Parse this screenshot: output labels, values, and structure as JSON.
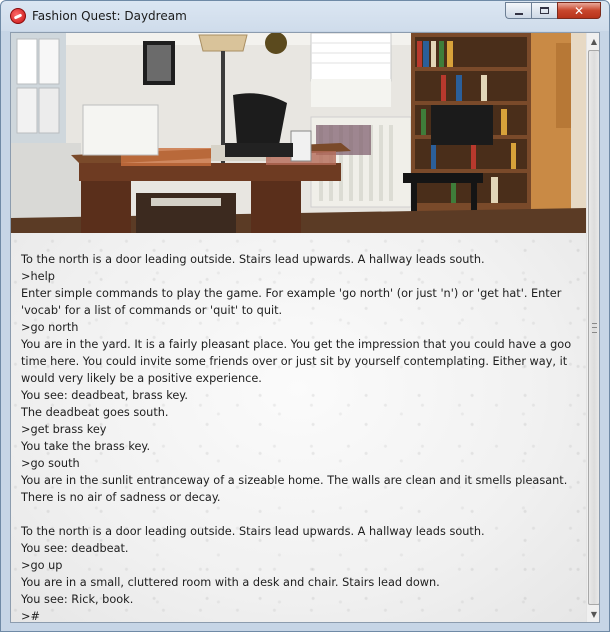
{
  "window": {
    "title": "Fashion Quest: Daydream",
    "min_icon": "minimize-icon",
    "max_icon": "maximize-icon",
    "close_glyph": "✕"
  },
  "scene": {
    "icon": "room-photo",
    "colors": {
      "wall": "#e9e7e2",
      "floor": "#5b3b25",
      "desk": "#6e3b22",
      "shelf": "#7a4a2a",
      "door": "#c98a45"
    }
  },
  "log": {
    "lines": [
      "To the north is a door leading outside. Stairs lead upwards. A hallway leads south.",
      ">help",
      "Enter simple commands to play the game. For example 'go north' (or just 'n') or 'get hat'. Enter",
      "'vocab' for a list of commands or 'quit' to quit.",
      ">go north",
      "You are in the yard. It is a fairly pleasant place. You get the impression that you could have a goo",
      "time here. You could invite some friends over or just sit by yourself contemplating. Either way, it",
      "would very likely be a positive experience.",
      "You see: deadbeat, brass key.",
      "The deadbeat goes south.",
      ">get brass key",
      "You take the brass key.",
      ">go south",
      "You are in the sunlit entranceway of a sizeable home. The walls are clean and it smells pleasant.",
      "There is no air of sadness or decay.",
      "",
      "To the north is a door leading outside. Stairs lead upwards. A hallway leads south.",
      "You see: deadbeat.",
      ">go up",
      "You are in a small, cluttered room with a desk and chair. Stairs lead down.",
      "You see: Rick, book.",
      ">#"
    ]
  },
  "scrollbar": {
    "up_arrow": "▲",
    "down_arrow": "▼"
  }
}
